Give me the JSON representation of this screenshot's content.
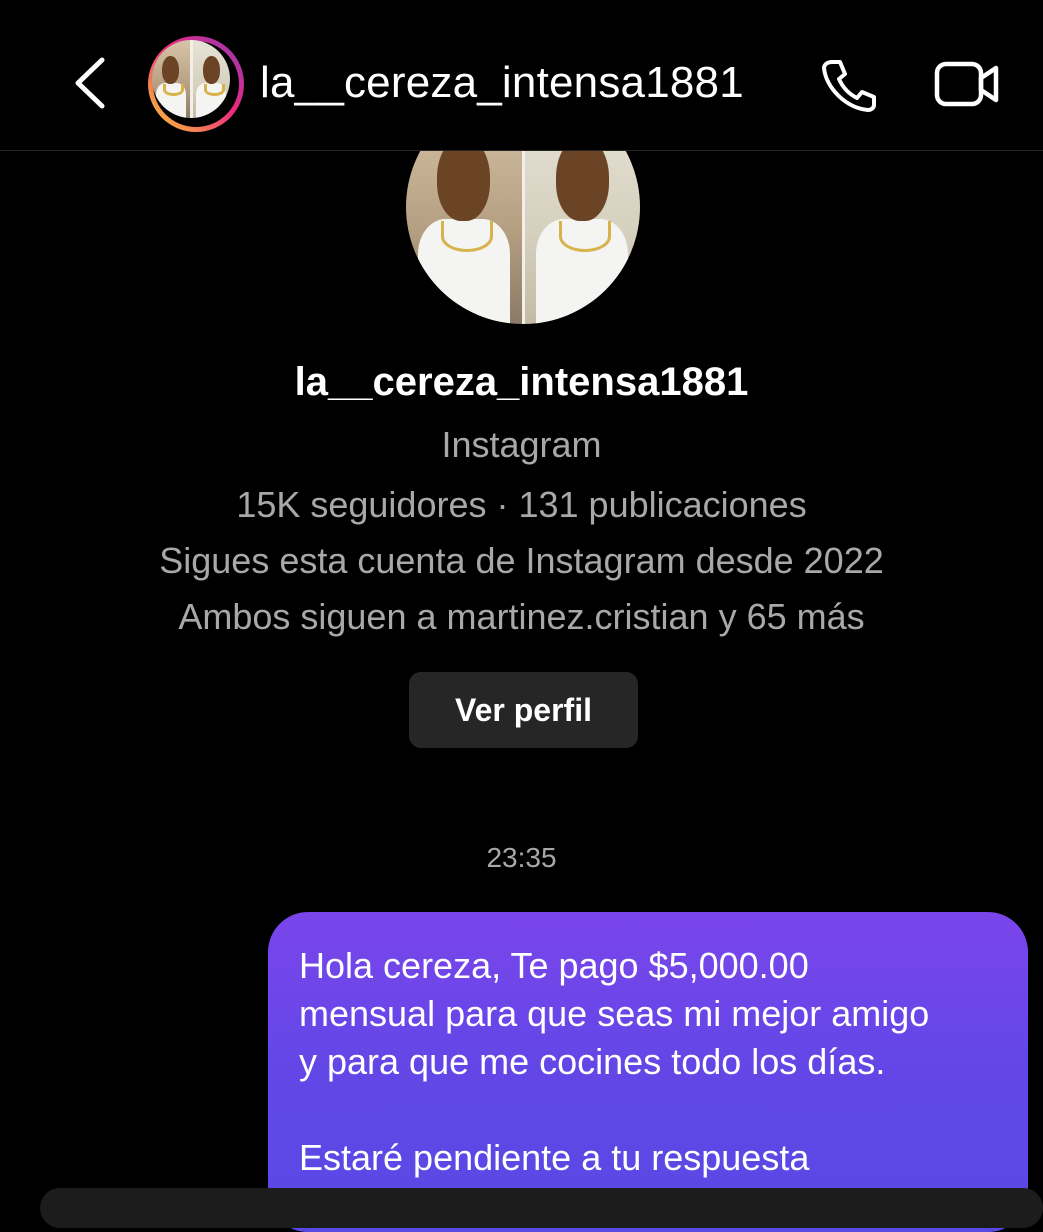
{
  "header": {
    "username": "la__cereza_intensa1881",
    "back_icon": "chevron-left-icon",
    "call_icon": "phone-icon",
    "video_icon": "video-camera-icon"
  },
  "profile": {
    "name": "la__cereza_intensa1881",
    "platform": "Instagram",
    "stats": "15K seguidores · 131 publicaciones",
    "following_since": "Sigues esta cuenta de Instagram desde 2022",
    "mutuals": "Ambos siguen a martinez.cristian y 65 más",
    "view_profile_label": "Ver perfil"
  },
  "messages": [
    {
      "time": "23:35",
      "lines": [
        "Hola cereza, Te pago $5,000.00",
        "mensual para que seas mi mejor amigo",
        "y para que me cocines todo los días.",
        "",
        "Estaré pendiente a tu respuesta"
      ]
    }
  ],
  "colors": {
    "background": "#000000",
    "bubble_top": "#7a45eb",
    "bubble_bottom": "#5849e4",
    "secondary_text": "#a8a8a8",
    "button_bg": "#262626"
  }
}
